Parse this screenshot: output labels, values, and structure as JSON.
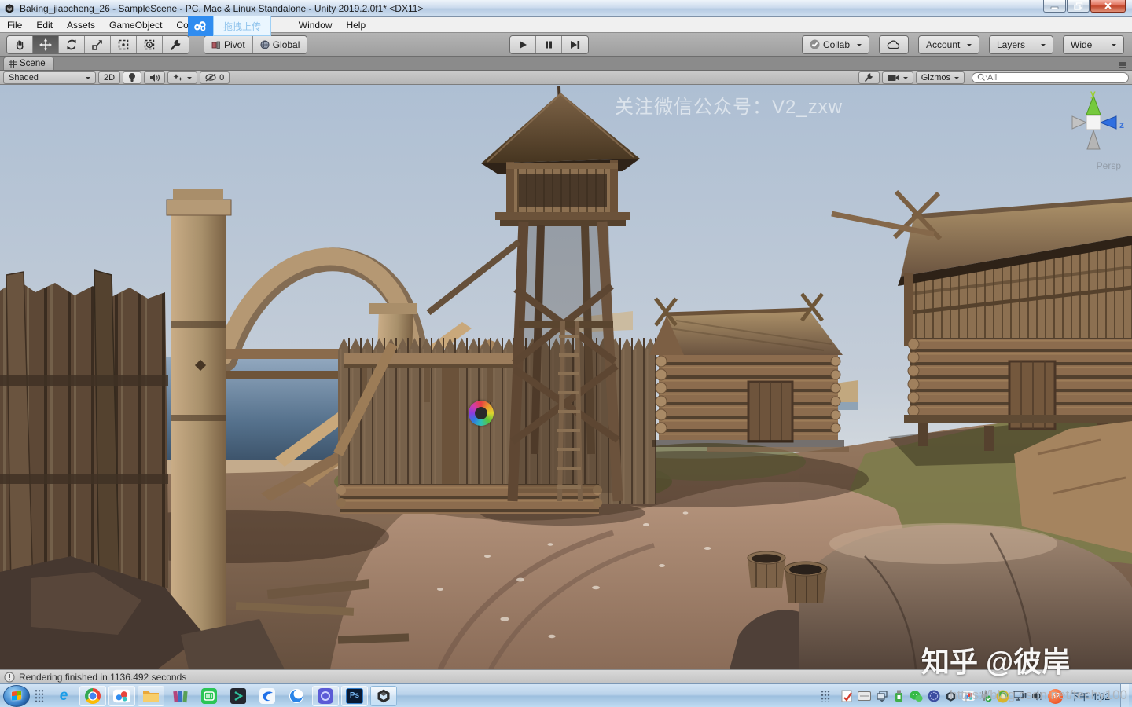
{
  "window": {
    "title": "Baking_jiaocheng_26 - SampleScene - PC, Mac & Linux Standalone - Unity 2019.2.0f1* <DX11>"
  },
  "menu_bar": {
    "items": [
      "File",
      "Edit",
      "Assets",
      "GameObject",
      "Com"
    ],
    "items_right": [
      "Window",
      "Help"
    ],
    "upload_overlay_label": "拖拽上传"
  },
  "toolbar": {
    "pivot": "Pivot",
    "global": "Global",
    "collab": "Collab",
    "account": "Account",
    "layers": "Layers",
    "layout": "Wide"
  },
  "scene_panel": {
    "tab": "Scene",
    "draw_mode": "Shaded",
    "mode_2d": "2D",
    "hidden_count": "0",
    "gizmos": "Gizmos",
    "search_placeholder": "All",
    "gizmo_axis_y": "y",
    "gizmo_axis_z": "z",
    "projection": "Persp"
  },
  "viewport_watermarks": {
    "top": "关注微信公众号：V2_zxw",
    "bottom_right": "知乎 @彼岸",
    "url": "https://blog.csdn.net/techy100"
  },
  "status_bar": {
    "message": "Rendering finished in 1136.492 seconds"
  },
  "taskbar": {
    "tray_percent": "52",
    "clock": "下午 4:02"
  },
  "icons": {
    "ie_glyph": "e",
    "photoshop_glyph": "Ps"
  },
  "colors": {
    "accent_blue": "#2f8cf0",
    "close_red": "#c04328",
    "sky_top": "#aebfd3",
    "ground": "#7c6150"
  }
}
